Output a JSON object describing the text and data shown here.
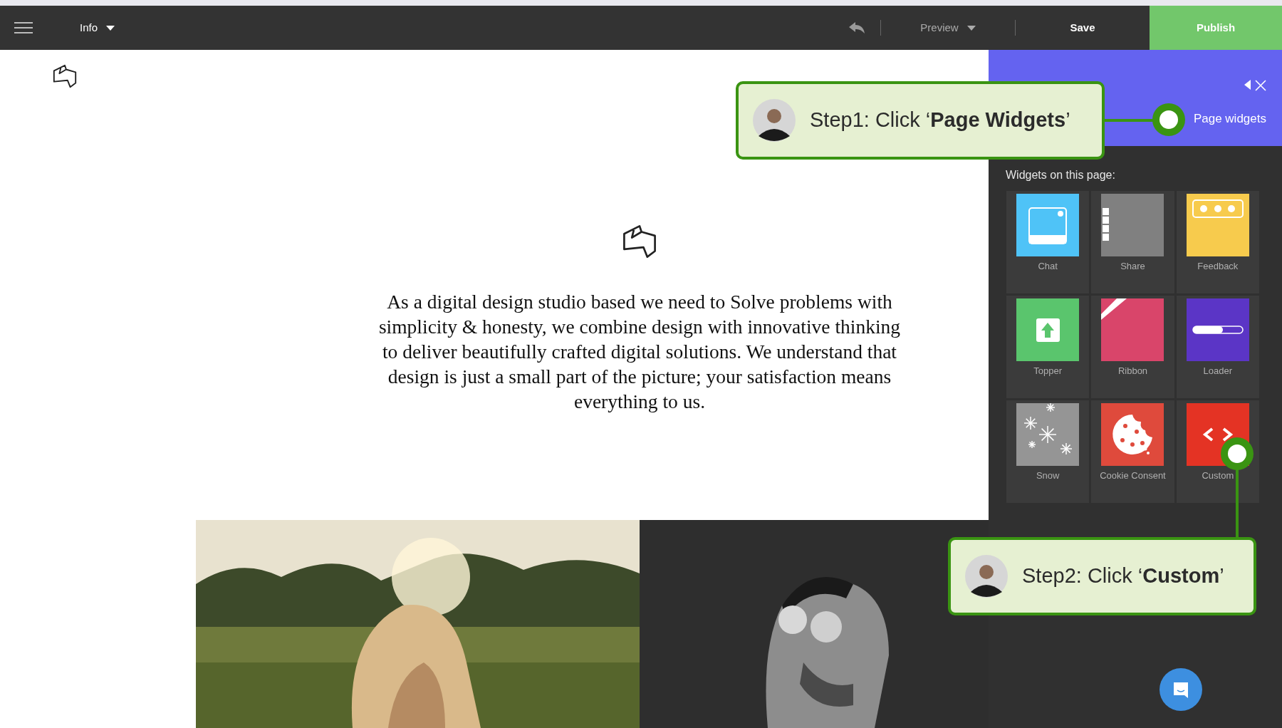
{
  "topbar": {
    "menu": {
      "label": "Info"
    },
    "actions": [
      {
        "label": "Preview",
        "kind": "dropdown"
      },
      {
        "label": "Save",
        "kind": "plain"
      },
      {
        "label": "Publish",
        "kind": "primary"
      }
    ]
  },
  "page": {
    "text": "As a digital design studio based we need to Solve problems with simplicity & honesty, we combine design with innovative thinking to deliver beautifully crafted digital solutions. We understand that design is just a small part of the picture; your satisfaction means everything to us."
  },
  "panel": {
    "tabs": [
      {
        "label": "Page widgets",
        "selected": true
      }
    ],
    "heading": "Widgets on this page:",
    "widgets": [
      {
        "label": "Chat",
        "kind": "chat",
        "color": "#4fc3f7"
      },
      {
        "label": "Share",
        "kind": "share",
        "color": "#808080"
      },
      {
        "label": "Feedback",
        "kind": "feedback",
        "color": "#f7cb4d"
      },
      {
        "label": "Topper",
        "kind": "topper",
        "color": "#5ac56d"
      },
      {
        "label": "Ribbon",
        "kind": "ribbon",
        "color": "#d9456a"
      },
      {
        "label": "Loader",
        "kind": "loader",
        "color": "#5b35c6"
      },
      {
        "label": "Snow",
        "kind": "snow",
        "color": "#959595"
      },
      {
        "label": "Cookie Consent",
        "kind": "cookie",
        "color": "#df4a3c"
      },
      {
        "label": "Custom",
        "kind": "custom",
        "color": "#e43324"
      }
    ]
  },
  "callouts": [
    {
      "text": "Step1: Click ‘**Page Widgets**’"
    },
    {
      "text": "Step2: Click ‘**Custom**’"
    }
  ]
}
